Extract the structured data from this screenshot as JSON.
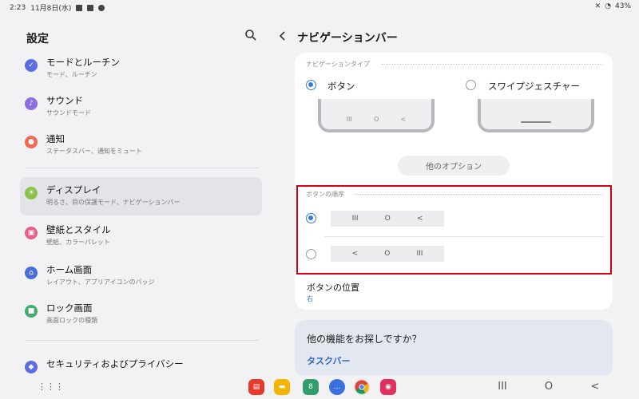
{
  "status": {
    "time": "2:23",
    "date": "11月8日(水)",
    "battery": "43%"
  },
  "left": {
    "title": "設定",
    "items": [
      {
        "title": "モードとルーチン",
        "subtitle": "モード、ルーチン",
        "icon": "mode-routine-icon",
        "color": "#5b6ee0"
      },
      {
        "title": "サウンド",
        "subtitle": "サウンドモード",
        "icon": "sound-icon",
        "color": "#8d6ee0"
      },
      {
        "title": "通知",
        "subtitle": "ステータスバー、通知をミュート",
        "icon": "notification-icon",
        "color": "#f06a4f"
      },
      {
        "title": "ディスプレイ",
        "subtitle": "明るさ、目の保護モード、ナビゲーションバー",
        "icon": "display-icon",
        "color": "#8bc34a"
      },
      {
        "title": "壁紙とスタイル",
        "subtitle": "壁紙、カラーパレット",
        "icon": "wallpaper-icon",
        "color": "#e85d8a"
      },
      {
        "title": "ホーム画面",
        "subtitle": "レイアウト、アプリアイコンのバッジ",
        "icon": "home-screen-icon",
        "color": "#4a6fd8"
      },
      {
        "title": "ロック画面",
        "subtitle": "画面ロックの種類",
        "icon": "lock-screen-icon",
        "color": "#3fae6a"
      },
      {
        "title": "セキュリティおよびプライバシー",
        "subtitle": "",
        "icon": "security-icon",
        "color": "#5b6ee0"
      }
    ]
  },
  "right": {
    "title": "ナビゲーションバー",
    "nav_type_label": "ナビゲーションタイプ",
    "option_buttons": "ボタン",
    "option_swipe": "スワイプジェスチャー",
    "other_options": "他のオプション",
    "button_order_label": "ボタンの順序",
    "order1": [
      "III",
      "O",
      "<"
    ],
    "order2": [
      "<",
      "O",
      "III"
    ],
    "position_title": "ボタンの位置",
    "position_value": "右",
    "more_title": "他の機能をお探しですか？",
    "more_link": "タスクバー"
  },
  "phone_keys": [
    "III",
    "O",
    "<"
  ],
  "colors": {
    "accent": "#3a7bd5",
    "highlight": "#d9000e"
  },
  "dock": [
    {
      "icon": "notes-app-icon",
      "color": "#e8392d"
    },
    {
      "icon": "files-app-icon",
      "color": "#f4b400"
    },
    {
      "icon": "calendar-app-icon",
      "color": "#2f9e6b"
    },
    {
      "icon": "messages-app-icon",
      "color": "#3a6fe0"
    },
    {
      "icon": "chrome-app-icon",
      "color": "#dddddd"
    },
    {
      "icon": "camera-app-icon",
      "color": "#e0305f"
    }
  ],
  "nav_keys": {
    "recents": "III",
    "home": "O",
    "back": "<"
  }
}
